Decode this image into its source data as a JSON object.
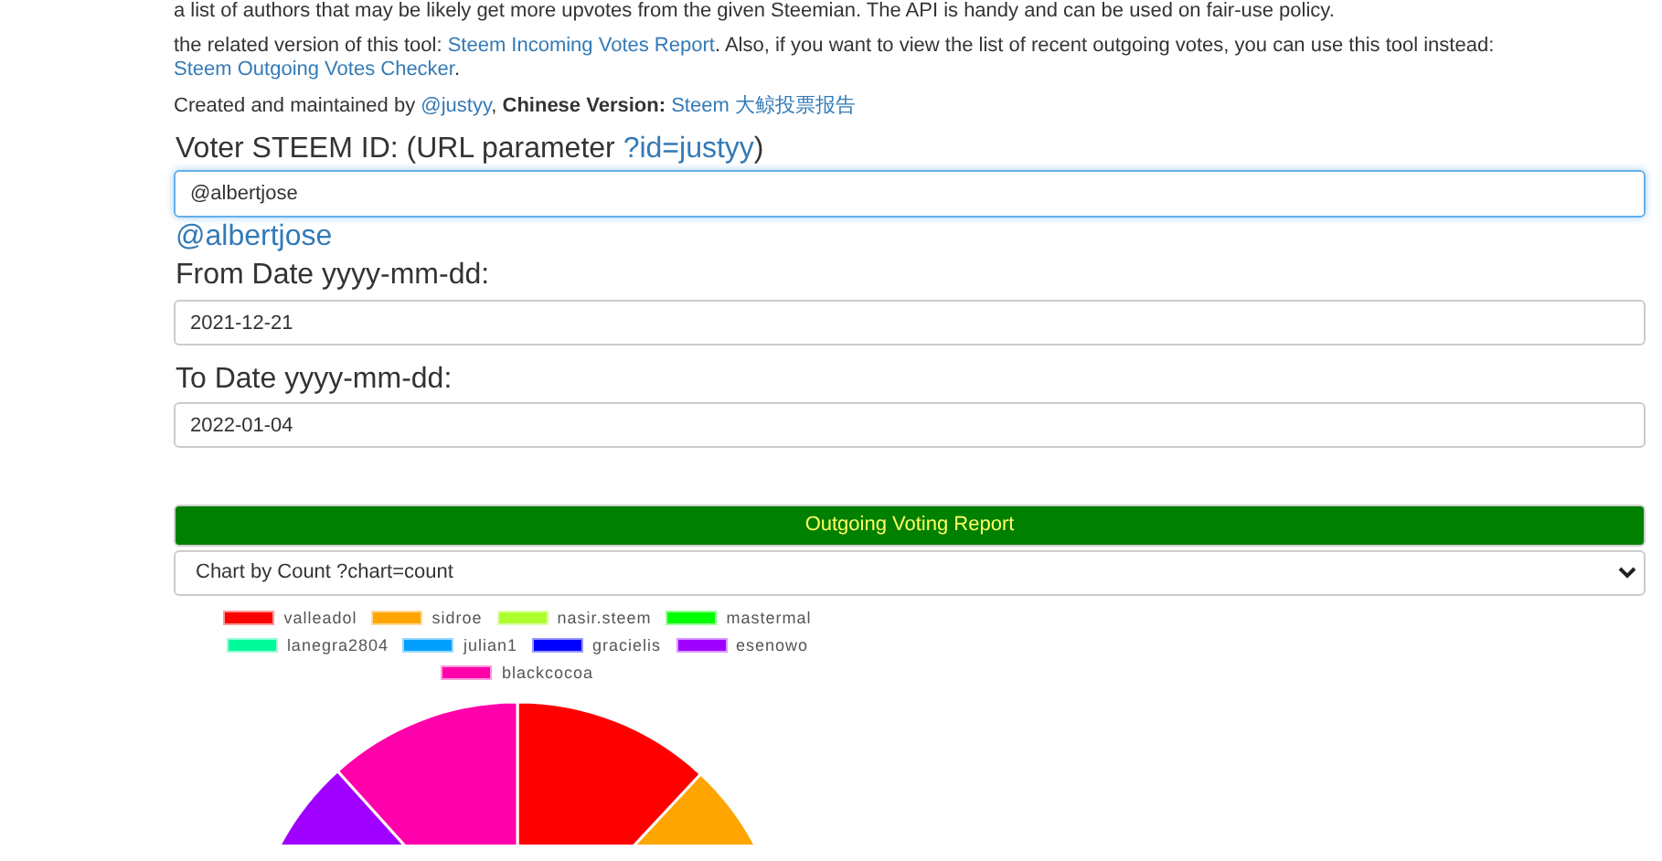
{
  "intro": [
    {
      "parts": [
        {
          "text": "a list of authors that may be likely get more upvotes from the given Steemian. The API is handy and can be used on fair-use policy.",
          "link": false
        }
      ]
    },
    {
      "parts": [
        {
          "text": "the related version of this tool: ",
          "link": false
        },
        {
          "text": "Steem Incoming Votes Report",
          "link": true
        },
        {
          "text": ". Also, if you want to view the list of recent outgoing votes, you can use this tool instead: ",
          "link": false
        },
        {
          "text": "Steem Outgoing Votes Checker",
          "link": true
        },
        {
          "text": ".",
          "link": false
        }
      ]
    },
    {
      "parts": [
        {
          "text": "Created and maintained by ",
          "link": false
        },
        {
          "text": "@justyy",
          "link": true
        },
        {
          "text": ", ",
          "link": false
        },
        {
          "text": "**Chinese Version:** ",
          "link": false
        },
        {
          "text": "Steem 大鲸投票报告",
          "link": true
        }
      ]
    }
  ],
  "voter": {
    "label": "Voter STEEM ID: (URL parameter ",
    "label_link": "?id=justyy",
    "label_end": ")",
    "value": "@albertjose",
    "profile_link": "@albertjose"
  },
  "from_date": {
    "label": "From Date yyyy-mm-dd:",
    "value": "2021-12-21"
  },
  "to_date": {
    "label": "To Date yyyy-mm-dd:",
    "value": "2022-01-04"
  },
  "report_button": "Outgoing Voting Report",
  "chart_select": "Chart by Count ?chart=count",
  "legend": [
    {
      "label": "valleadol",
      "color": "#ff0000"
    },
    {
      "label": "sidroe",
      "color": "#ffa500"
    },
    {
      "label": "nasir.steem",
      "color": "#adff2f"
    },
    {
      "label": "mastermal",
      "color": "#00ff00"
    },
    {
      "label": "lanegra2804",
      "color": "#00fa9a"
    },
    {
      "label": "julian1",
      "color": "#00a0ff"
    },
    {
      "label": "gracielis",
      "color": "#0000ff"
    },
    {
      "label": "esenowo",
      "color": "#a000ff"
    },
    {
      "label": "blackcocoa",
      "color": "#ff00aa"
    }
  ]
}
